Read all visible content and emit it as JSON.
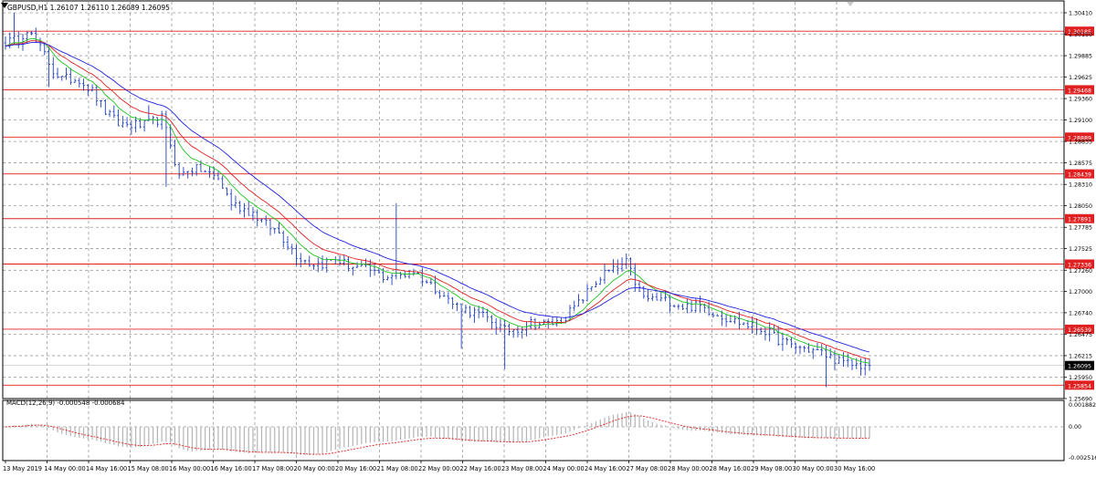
{
  "symbol_info": "GBPUSD,H1  1.26107 1.26110 1.26089 1.26095",
  "macd_label": "MACD(12,26,9) -0.000548 -0.000684",
  "colors": {
    "candle": "#1f3fbf",
    "ma_fast": "#21c421",
    "ma_mid": "#e02020",
    "ma_slow": "#2020e0",
    "level_line": "#e02020",
    "level_tag": "#e02020",
    "macd_hist": "#b4b4b4",
    "macd_signal": "#e02020",
    "grid": "#9a9a9a"
  },
  "chart_data": {
    "type": "candlestick",
    "symbol": "GBPUSD",
    "timeframe": "H1",
    "ylim": [
      1.2569,
      1.3041
    ],
    "y_ticks": [
      "1.30410",
      "1.30150",
      "1.29885",
      "1.29625",
      "1.29360",
      "1.29100",
      "1.28835",
      "1.28575",
      "1.28310",
      "1.28050",
      "1.27785",
      "1.27525",
      "1.27260",
      "1.27000",
      "1.26740",
      "1.26475",
      "1.26215",
      "1.25950",
      "1.25690"
    ],
    "x_labels": [
      "13 May 2019",
      "14 May 00:00",
      "14 May 16:00",
      "15 May 08:00",
      "16 May 00:00",
      "16 May 16:00",
      "17 May 08:00",
      "20 May 00:00",
      "20 May 16:00",
      "21 May 08:00",
      "22 May 00:00",
      "22 May 16:00",
      "23 May 08:00",
      "24 May 00:00",
      "24 May 16:00",
      "27 May 08:00",
      "28 May 00:00",
      "28 May 16:00",
      "29 May 08:00",
      "30 May 00:00",
      "30 May 16:00"
    ],
    "horizontal_levels": [
      "1.30185",
      "1.29468",
      "1.28889",
      "1.28439",
      "1.27891",
      "1.27336",
      "1.26539",
      "1.25854"
    ],
    "current_price": "1.26095",
    "close_path": [
      [
        0,
        1.3005
      ],
      [
        3,
        1.3008
      ],
      [
        5,
        1.3022
      ],
      [
        7,
        1.3004
      ],
      [
        9,
        1.299
      ],
      [
        11,
        1.297
      ],
      [
        13,
        1.296
      ],
      [
        17,
        1.296
      ],
      [
        20,
        1.2945
      ],
      [
        23,
        1.292
      ],
      [
        26,
        1.2905
      ],
      [
        32,
        1.2903
      ],
      [
        35,
        1.291
      ],
      [
        36,
        1.2912
      ],
      [
        38,
        1.288
      ],
      [
        40,
        1.284
      ],
      [
        42,
        1.285
      ],
      [
        45,
        1.2849
      ],
      [
        49,
        1.2838
      ],
      [
        52,
        1.2808
      ],
      [
        57,
        1.2796
      ],
      [
        60,
        1.2782
      ],
      [
        63,
        1.2772
      ],
      [
        67,
        1.2745
      ],
      [
        70,
        1.2735
      ],
      [
        73,
        1.2734
      ],
      [
        76,
        1.274
      ],
      [
        79,
        1.2732
      ],
      [
        82,
        1.2728
      ],
      [
        84,
        1.2726
      ],
      [
        87,
        1.2718
      ],
      [
        89,
        1.272
      ],
      [
        90,
        1.2719
      ],
      [
        92,
        1.2721
      ],
      [
        94,
        1.2725
      ],
      [
        97,
        1.2712
      ],
      [
        100,
        1.27
      ],
      [
        103,
        1.2685
      ],
      [
        106,
        1.2678
      ],
      [
        109,
        1.2672
      ],
      [
        112,
        1.2664
      ],
      [
        115,
        1.2652
      ],
      [
        118,
        1.2655
      ],
      [
        121,
        1.2662
      ],
      [
        124,
        1.266
      ],
      [
        127,
        1.2662
      ],
      [
        129,
        1.267
      ],
      [
        132,
        1.2685
      ],
      [
        135,
        1.2706
      ],
      [
        138,
        1.2722
      ],
      [
        141,
        1.2728
      ],
      [
        143,
        1.2735
      ],
      [
        145,
        1.2712
      ],
      [
        147,
        1.2692
      ],
      [
        150,
        1.269
      ],
      [
        153,
        1.2688
      ],
      [
        156,
        1.2682
      ],
      [
        160,
        1.2682
      ],
      [
        163,
        1.2675
      ],
      [
        166,
        1.2668
      ],
      [
        169,
        1.2662
      ],
      [
        172,
        1.2657
      ],
      [
        175,
        1.2652
      ],
      [
        178,
        1.2641
      ],
      [
        181,
        1.2634
      ],
      [
        184,
        1.263
      ],
      [
        187,
        1.2627
      ],
      [
        189,
        1.2622
      ],
      [
        191,
        1.2618
      ],
      [
        193,
        1.2612
      ],
      [
        196,
        1.261
      ],
      [
        199,
        1.26095
      ]
    ],
    "spikes": [
      [
        2,
        1.3041
      ],
      [
        10,
        1.295
      ],
      [
        33,
        1.2928
      ],
      [
        37,
        1.2828
      ],
      [
        90,
        1.2808
      ],
      [
        105,
        1.263
      ],
      [
        115,
        1.2605
      ],
      [
        189,
        1.2583
      ]
    ]
  }
}
